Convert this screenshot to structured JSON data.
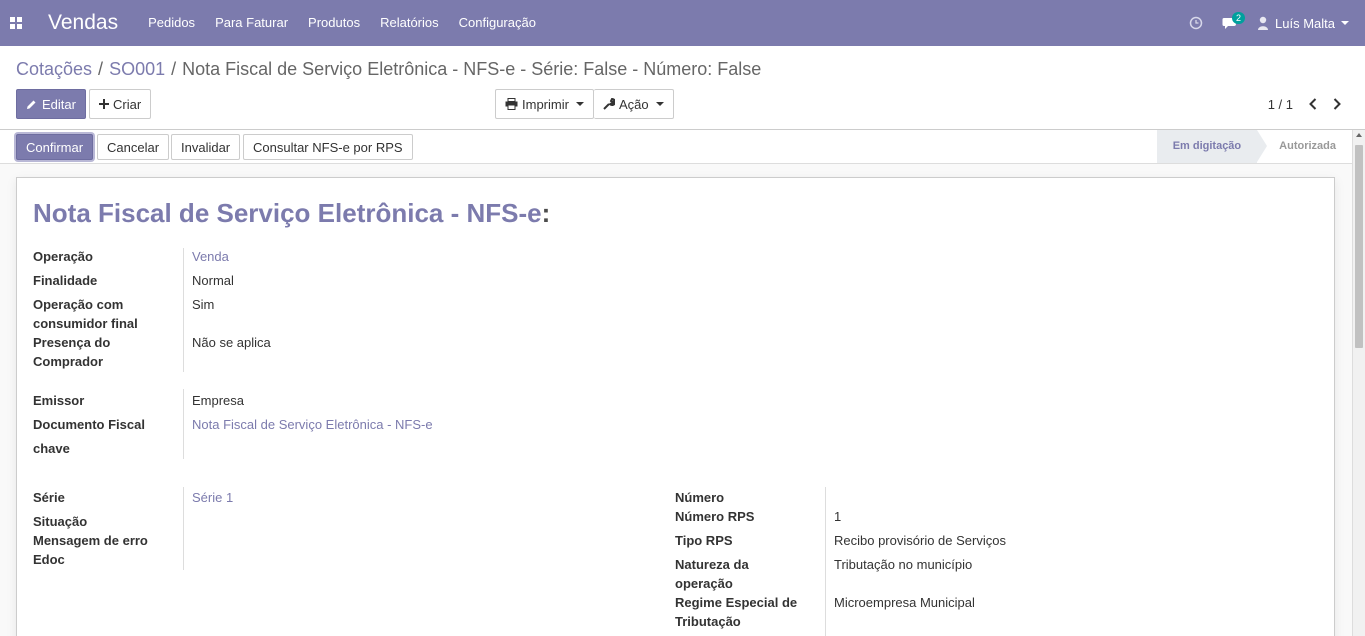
{
  "navbar": {
    "app_name": "Vendas",
    "menu": [
      "Pedidos",
      "Para Faturar",
      "Produtos",
      "Relatórios",
      "Configuração"
    ],
    "messages_badge": "2",
    "user_name": "Luís Malta",
    "icons": [
      "apps-icon",
      "clock-icon",
      "chat-icon",
      "user-icon"
    ]
  },
  "breadcrumb": {
    "items": [
      "Cotações",
      "SO001"
    ],
    "separator": "/",
    "current": "Nota Fiscal de Serviço Eletrônica - NFS-e - Série: False - Número: False"
  },
  "toolbar": {
    "edit_label": "Editar",
    "create_label": "Criar",
    "print_label": "Imprimir",
    "action_label": "Ação"
  },
  "pager": {
    "value": "1 / 1"
  },
  "header_buttons": {
    "confirm": "Confirmar",
    "cancel": "Cancelar",
    "invalidate": "Invalidar",
    "query_rps": "Consultar NFS-e por RPS"
  },
  "statusbar": {
    "stages": [
      "Em digitação",
      "Autorizada"
    ],
    "current": "Em digitação"
  },
  "form": {
    "title": "Nota Fiscal de Serviço Eletrônica - NFS-e",
    "title_suffix": ":",
    "group1": {
      "operacao_label": "Operação",
      "operacao_value": "Venda",
      "finalidade_label": "Finalidade",
      "finalidade_value": "Normal",
      "consumidor_label_1": "Operação com",
      "consumidor_label_2": "consumidor final",
      "consumidor_value": "Sim",
      "presenca_label_1": "Presença do",
      "presenca_label_2": "Comprador",
      "presenca_value": "Não se aplica"
    },
    "group2": {
      "emissor_label": "Emissor",
      "emissor_value": "Empresa",
      "documento_label": "Documento Fiscal",
      "documento_value": "Nota Fiscal de Serviço Eletrônica - NFS-e",
      "chave_label": "chave"
    },
    "group3": {
      "serie_label": "Série",
      "serie_value": "Série 1",
      "situacao_label": "Situação",
      "mensagem_label": "Mensagem de erro",
      "edoc_label": "Edoc"
    },
    "group4": {
      "numero_label": "Número",
      "numero_rps_label": "Número RPS",
      "numero_rps_value": "1",
      "tipo_rps_label": "Tipo RPS",
      "tipo_rps_value": "Recibo provisório de Serviços",
      "natureza_label_1": "Natureza da",
      "natureza_label_2": "operação",
      "natureza_value": "Tributação no município",
      "regime_label_1": "Regime Especial de",
      "regime_label_2": "Tributação",
      "regime_value": "Microempresa Municipal"
    }
  },
  "colors": {
    "brand": "#7c7bad",
    "badge": "#00a09d"
  }
}
